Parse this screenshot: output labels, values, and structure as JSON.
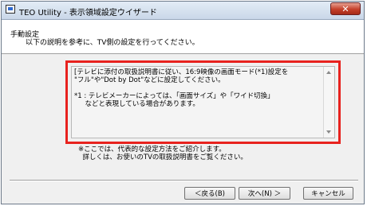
{
  "window": {
    "title": "TEO Utility - 表示領域設定ウイザード",
    "close_symbol": "✕",
    "icon": "app-window-icon"
  },
  "header": {
    "heading": "手動設定",
    "subheading": "以下の説明を参考に、TV側の設定を行ってください。"
  },
  "instructions": {
    "text": "[テレビに添付の取扱説明書に従い、16:9映像の画面モード(*1)設定を\n\"フル\"や\"Dot by Dot\"などに設定してください。\n\n*1 : テレビメーカーによっては、「画面サイズ」や「ワイド切換」\n     などと表現している場合があります。",
    "highlight_color": "#e8221e"
  },
  "note": {
    "text": "※ここでは、代表的な設定方法をご紹介します。\n  詳しくは、お使いのTVの取扱説明書をご覧ください。"
  },
  "buttons": {
    "back": "＜戻る(B)",
    "next": "次へ(N) ＞",
    "cancel": "キャンセル"
  }
}
